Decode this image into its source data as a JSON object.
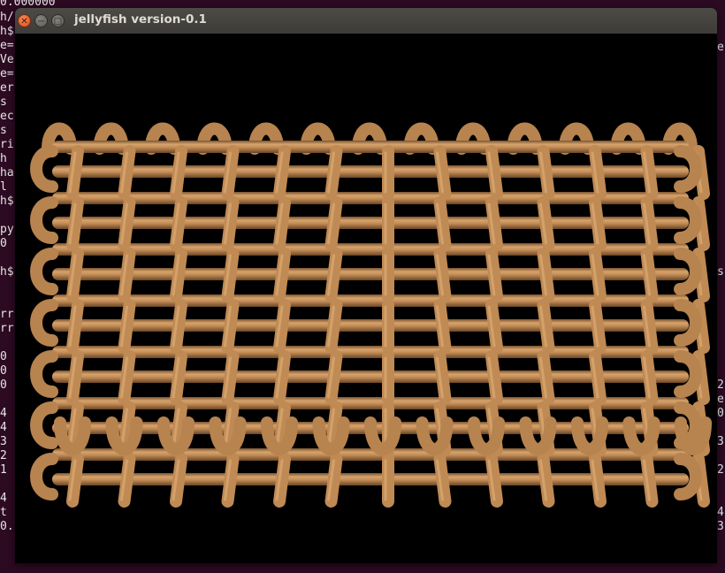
{
  "window": {
    "title": "jellyfish version-0.1",
    "buttons": {
      "close_icon": "close-icon",
      "minimize_icon": "minimize-icon",
      "maximize_icon": "maximize-icon"
    }
  },
  "terminal_fragments": [
    "0.000000",
    "h/",
    "h$",
    "e=",
    "Ve",
    "e=",
    "er",
    "s",
    "ec",
    "s",
    "ri",
    "h",
    "ha",
    "l",
    "h$",
    "py",
    "0",
    "h$",
    "rr",
    "rr",
    "0",
    "0",
    "0",
    "4",
    "4",
    "3",
    "2",
    "1",
    "4",
    "t",
    "0."
  ],
  "terminal_right_fragments": [
    "e",
    "s",
    "2",
    "e",
    "0",
    "3",
    "2",
    "4",
    "3"
  ],
  "colors": {
    "terminal_bg": "#2c0a22",
    "titlebar": "#3d3c38",
    "close_button": "#df4a16",
    "knit_yarn": "#c8935e"
  }
}
